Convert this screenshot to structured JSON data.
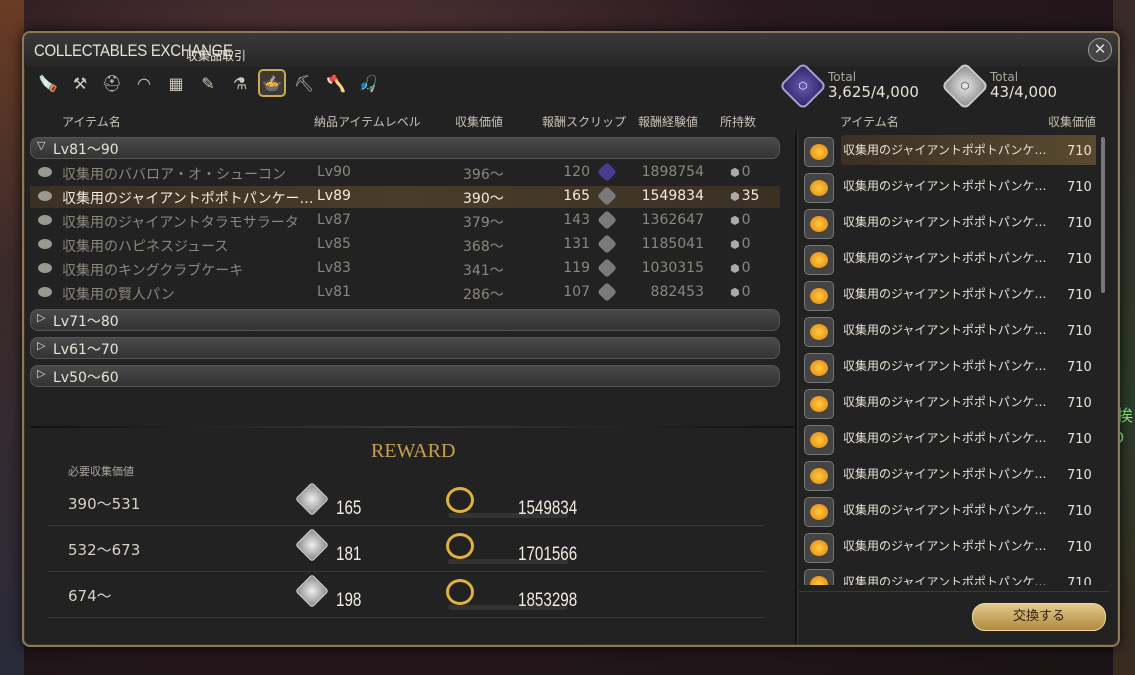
{
  "window": {
    "title": "COLLECTABLES EXCHANGE",
    "subtitle": "収集品取引",
    "close_icon": "close-icon"
  },
  "tabs": [
    {
      "icon": "carpenter-icon"
    },
    {
      "icon": "blacksmith-icon"
    },
    {
      "icon": "armorer-icon"
    },
    {
      "icon": "goldsmith-icon"
    },
    {
      "icon": "leatherworker-icon"
    },
    {
      "icon": "weaver-icon"
    },
    {
      "icon": "alchemist-icon"
    },
    {
      "icon": "culinarian-icon",
      "active": true
    },
    {
      "icon": "miner-icon"
    },
    {
      "icon": "botanist-icon"
    },
    {
      "icon": "fisher-icon"
    }
  ],
  "currencies": [
    {
      "label": "Total",
      "value": "3,625/4,000",
      "icon": "purple-scrip-icon"
    },
    {
      "label": "Total",
      "value": "43/4,000",
      "icon": "white-scrip-icon"
    }
  ],
  "columns": {
    "item_name": "アイテム名",
    "level": "納品アイテムレベル",
    "collectability": "収集価値",
    "scrip": "報酬スクリップ",
    "exp": "報酬経験値",
    "owned": "所持数"
  },
  "groups": [
    {
      "label": "Lv81～90",
      "expanded": true
    },
    {
      "label": "Lv71～80"
    },
    {
      "label": "Lv61～70"
    },
    {
      "label": "Lv50～60"
    }
  ],
  "items": [
    {
      "name": "収集用のババロア・オ・シューコン",
      "level": "Lv90",
      "collectability": "396～",
      "scrip": "120",
      "exp": "1898754",
      "owned": "0",
      "purple": true
    },
    {
      "name": "収集用のジャイアントポポトパンケー…",
      "level": "Lv89",
      "collectability": "390～",
      "scrip": "165",
      "exp": "1549834",
      "owned": "35",
      "selected": true
    },
    {
      "name": "収集用のジャイアントタラモサラータ",
      "level": "Lv87",
      "collectability": "379～",
      "scrip": "143",
      "exp": "1362647",
      "owned": "0"
    },
    {
      "name": "収集用のハピネスジュース",
      "level": "Lv85",
      "collectability": "368～",
      "scrip": "131",
      "exp": "1185041",
      "owned": "0"
    },
    {
      "name": "収集用のキングクラブケーキ",
      "level": "Lv83",
      "collectability": "341～",
      "scrip": "119",
      "exp": "1030315",
      "owned": "0"
    },
    {
      "name": "収集用の賢人パン",
      "level": "Lv81",
      "collectability": "286～",
      "scrip": "107",
      "exp": "882453",
      "owned": "0"
    }
  ],
  "reward": {
    "title": "REWARD",
    "req_label": "必要収集価値",
    "tiers": [
      {
        "range": "390～531",
        "scrip": "165",
        "exp": "1549834"
      },
      {
        "range": "532～673",
        "scrip": "181",
        "exp": "1701566"
      },
      {
        "range": "674～",
        "scrip": "198",
        "exp": "1853298"
      }
    ]
  },
  "right_pane": {
    "col_name": "アイテム名",
    "col_value": "収集価値",
    "entries": [
      {
        "name": "収集用のジャイアントポポトパンケ…",
        "value": "710"
      },
      {
        "name": "収集用のジャイアントポポトパンケ…",
        "value": "710"
      },
      {
        "name": "収集用のジャイアントポポトパンケ…",
        "value": "710"
      },
      {
        "name": "収集用のジャイアントポポトパンケ…",
        "value": "710"
      },
      {
        "name": "収集用のジャイアントポポトパンケ…",
        "value": "710"
      },
      {
        "name": "収集用のジャイアントポポトパンケ…",
        "value": "710"
      },
      {
        "name": "収集用のジャイアントポポトパンケ…",
        "value": "710"
      },
      {
        "name": "収集用のジャイアントポポトパンケ…",
        "value": "710"
      },
      {
        "name": "収集用のジャイアントポポトパンケ…",
        "value": "710"
      },
      {
        "name": "収集用のジャイアントポポトパンケ…",
        "value": "710"
      },
      {
        "name": "収集用のジャイアントポポトパンケ…",
        "value": "710"
      },
      {
        "name": "収集用のジャイアントポポトパンケ…",
        "value": "710"
      },
      {
        "name": "収集用のジャイアントポポトパンケ…",
        "value": "710"
      }
    ],
    "exchange_label": "交換する"
  },
  "background": {
    "right_text": "ご挨\nAD"
  }
}
